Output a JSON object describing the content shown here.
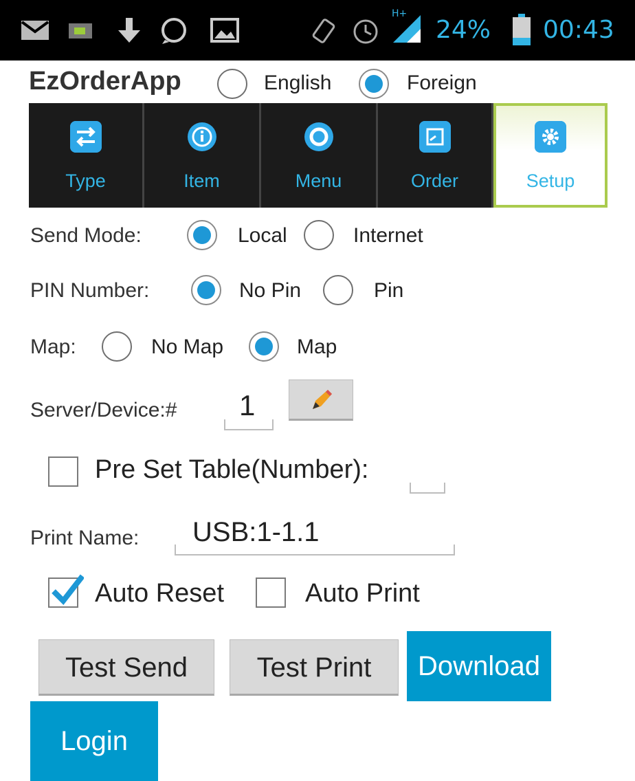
{
  "status_bar": {
    "icons": [
      "mail-icon",
      "battery-saver-icon",
      "download-icon",
      "whatsapp-icon",
      "image-icon",
      "vibrate-icon",
      "alarm-icon",
      "signal-icon"
    ],
    "network": "H+",
    "battery_percent": "24%",
    "time": "00:43",
    "accent_color": "#33b5e5"
  },
  "header": {
    "app_title": "EzOrderApp",
    "language_options": [
      {
        "label": "English",
        "selected": false
      },
      {
        "label": "Foreign",
        "selected": true
      }
    ]
  },
  "tabs": [
    {
      "label": "Type",
      "icon": "swap-arrows-icon",
      "active": false
    },
    {
      "label": "Item",
      "icon": "info-icon",
      "active": false
    },
    {
      "label": "Menu",
      "icon": "refresh-icon",
      "active": false
    },
    {
      "label": "Order",
      "icon": "order-icon",
      "active": false
    },
    {
      "label": "Setup",
      "icon": "gear-icon",
      "active": true
    }
  ],
  "settings": {
    "send_mode": {
      "label": "Send Mode:",
      "options": [
        {
          "label": "Local",
          "selected": true
        },
        {
          "label": "Internet",
          "selected": false
        }
      ]
    },
    "pin_number": {
      "label": "PIN Number:",
      "options": [
        {
          "label": "No Pin",
          "selected": true
        },
        {
          "label": "Pin",
          "selected": false
        }
      ]
    },
    "map": {
      "label": "Map:",
      "options": [
        {
          "label": "No Map",
          "selected": false
        },
        {
          "label": "Map",
          "selected": true
        }
      ]
    },
    "server_device": {
      "label": "Server/Device:#",
      "value": "1",
      "edit_icon": "pencil-icon"
    },
    "preset_table": {
      "label": "Pre Set Table(Number):",
      "checked": false,
      "value": ""
    },
    "print_name": {
      "label": "Print Name:",
      "value": "USB:1-1.1"
    },
    "auto_reset": {
      "label": "Auto Reset",
      "checked": true
    },
    "auto_print": {
      "label": "Auto Print",
      "checked": false
    }
  },
  "buttons": {
    "test_send": "Test Send",
    "test_print": "Test Print",
    "download": "Download",
    "login": "Login",
    "primary_color": "#0099cc"
  }
}
